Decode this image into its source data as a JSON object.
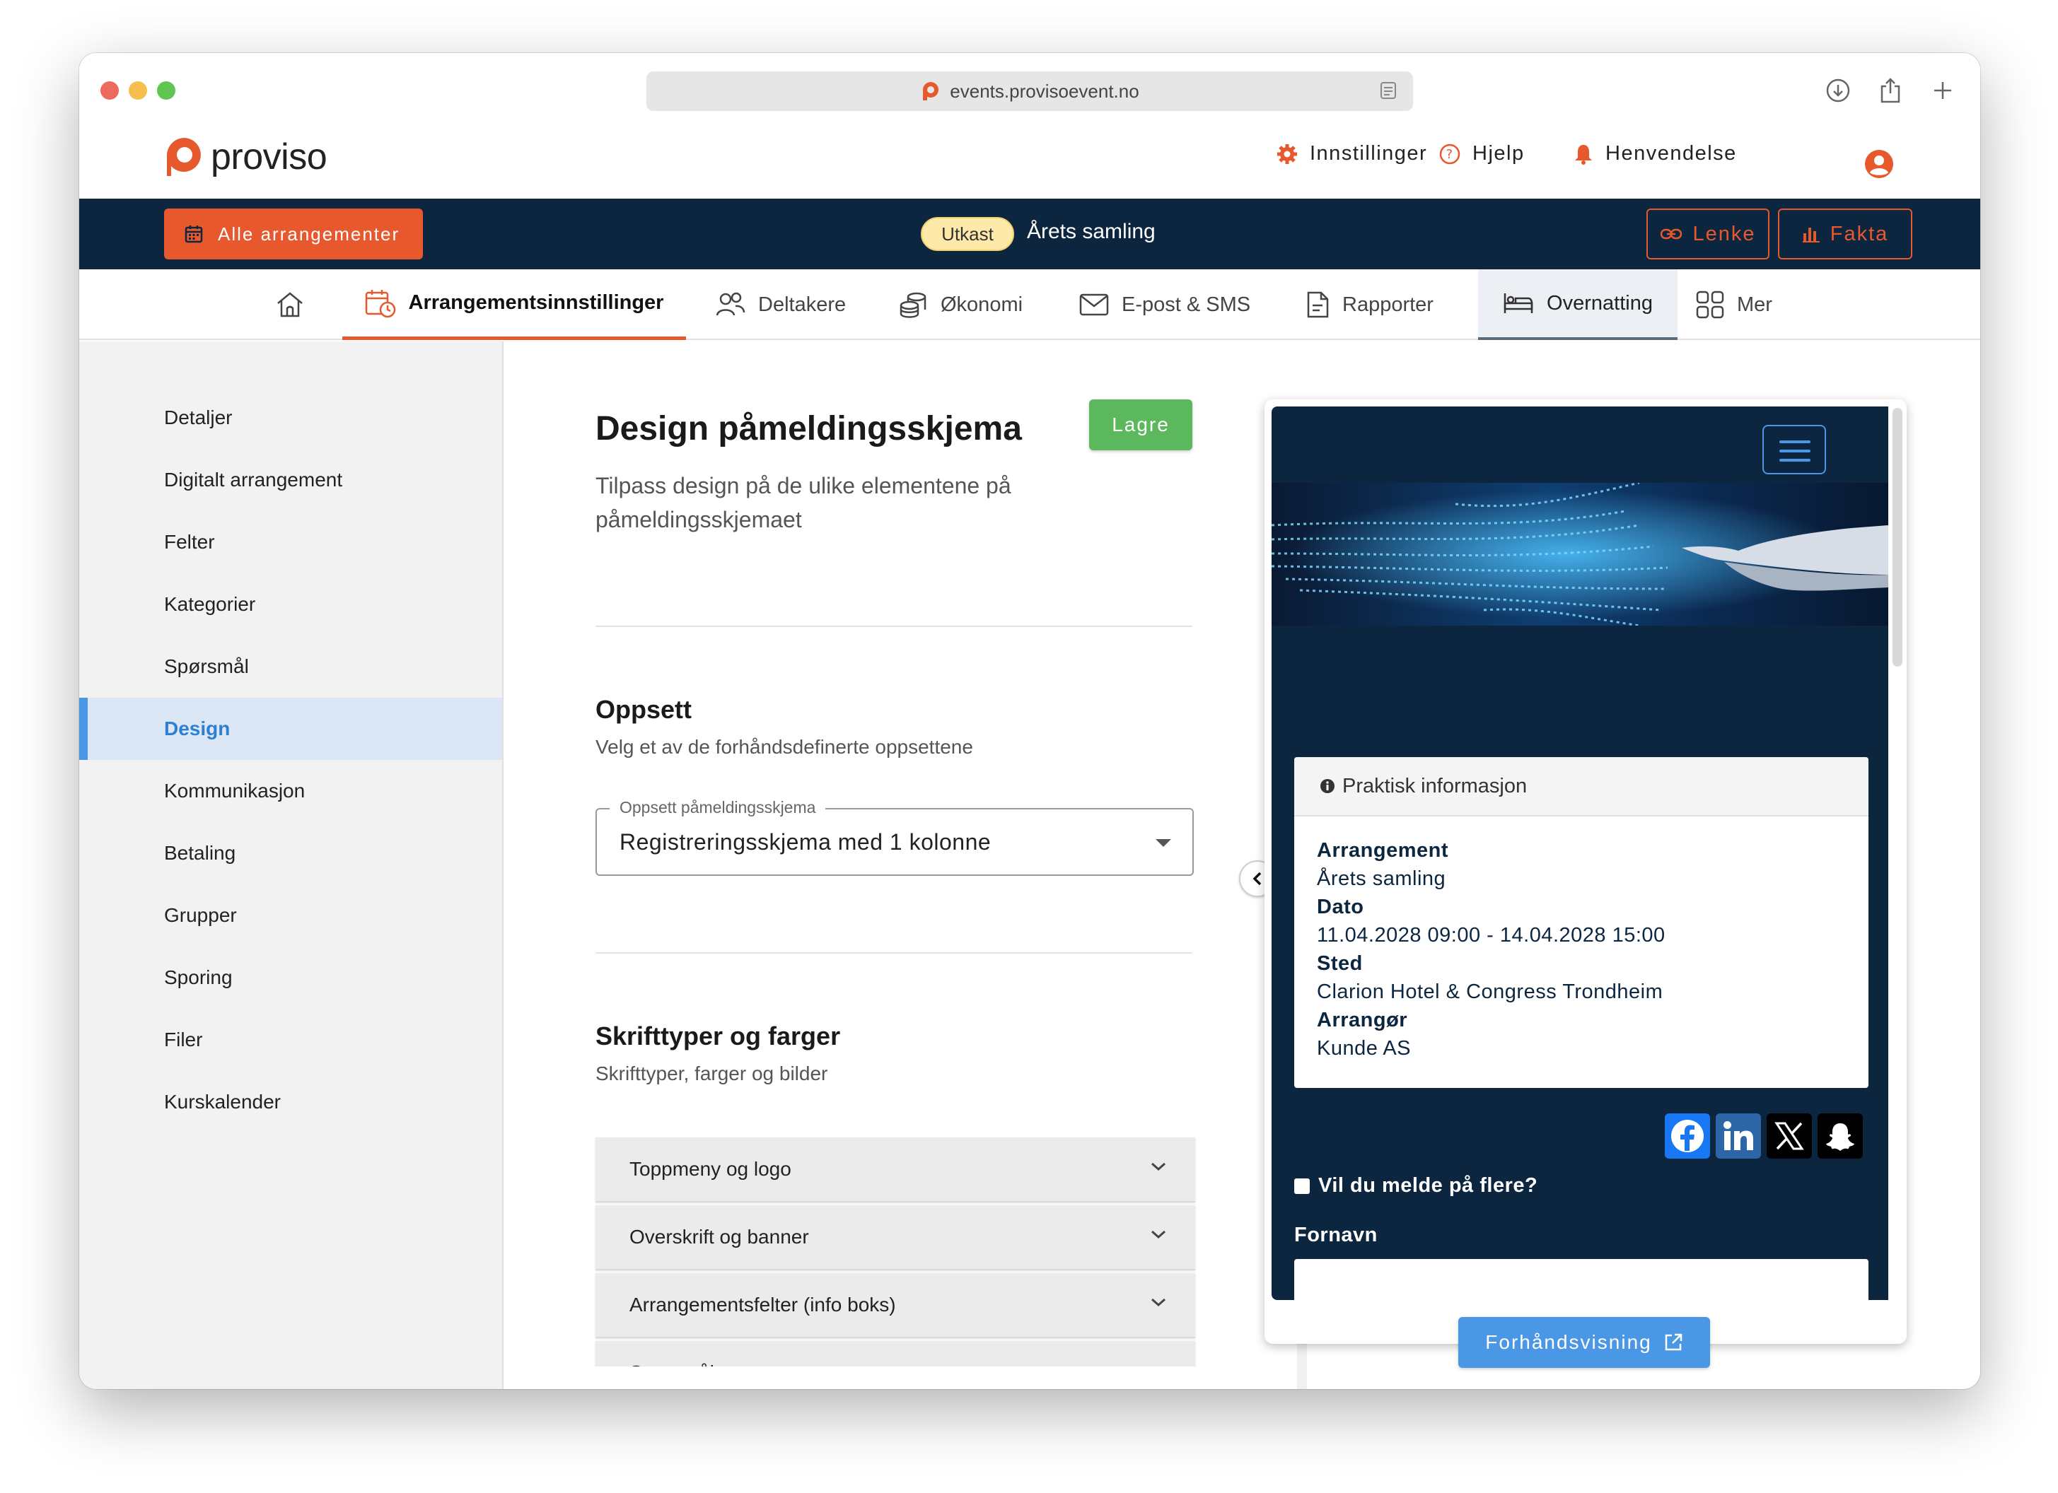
{
  "browser": {
    "url": "events.provisoevent.no"
  },
  "brand": {
    "name": "proviso",
    "accent": "#e8582d",
    "navy": "#0c2640",
    "blue": "#4a97e6",
    "green": "#5cb85c"
  },
  "topnav": {
    "settings": "Innstillinger",
    "help": "Hjelp",
    "inquiry": "Henvendelse"
  },
  "eventbar": {
    "all_events": "Alle arrangementer",
    "status": "Utkast",
    "title": "Årets samling",
    "link": "Lenke",
    "facts": "Fakta"
  },
  "tabs": [
    {
      "label": "",
      "icon": "home-icon"
    },
    {
      "label": "Arrangementsinnstillinger",
      "icon": "calendar-clock-icon"
    },
    {
      "label": "Deltakere",
      "icon": "users-icon"
    },
    {
      "label": "Økonomi",
      "icon": "coins-icon"
    },
    {
      "label": "E-post & SMS",
      "icon": "mail-icon"
    },
    {
      "label": "Rapporter",
      "icon": "report-icon"
    },
    {
      "label": "Overnatting",
      "icon": "bed-icon"
    },
    {
      "label": "Mer",
      "icon": "grid-icon"
    }
  ],
  "sidebar": {
    "items": [
      {
        "label": "Detaljer"
      },
      {
        "label": "Digitalt arrangement"
      },
      {
        "label": "Felter"
      },
      {
        "label": "Kategorier"
      },
      {
        "label": "Spørsmål"
      },
      {
        "label": "Design"
      },
      {
        "label": "Kommunikasjon"
      },
      {
        "label": "Betaling"
      },
      {
        "label": "Grupper"
      },
      {
        "label": "Sporing"
      },
      {
        "label": "Filer"
      },
      {
        "label": "Kurskalender"
      }
    ]
  },
  "main": {
    "title": "Design påmeldingsskjema",
    "save": "Lagre",
    "subtitle": "Tilpass design på de ulike elementene på påmeldingsskjemaet",
    "setup": {
      "heading": "Oppsett",
      "description": "Velg et av de forhåndsdefinerte oppsettene",
      "select_label": "Oppsett påmeldingsskjema",
      "select_value": "Registreringsskjema med 1 kolonne"
    },
    "fonts": {
      "heading": "Skrifttyper og farger",
      "description": "Skrifttyper, farger og bilder"
    },
    "accordion": [
      {
        "label": "Toppmeny og logo"
      },
      {
        "label": "Overskrift og banner"
      },
      {
        "label": "Arrangementsfelter (info boks)"
      },
      {
        "label": "Spørsmål"
      }
    ]
  },
  "preview": {
    "info_title": "Praktisk informasjon",
    "rows": [
      {
        "label": "Arrangement",
        "value": "Årets samling"
      },
      {
        "label": "Dato",
        "value": "11.04.2028 09:00 - 14.04.2028 15:00"
      },
      {
        "label": "Sted",
        "value": "Clarion Hotel & Congress Trondheim"
      },
      {
        "label": "Arrangør",
        "value": "Kunde AS"
      }
    ],
    "social": [
      "facebook-icon",
      "linkedin-icon",
      "x-icon",
      "snapchat-icon"
    ],
    "checkbox_label": "Vil du melde på flere?",
    "field_label": "Fornavn",
    "preview_button": "Forhåndsvisning"
  }
}
